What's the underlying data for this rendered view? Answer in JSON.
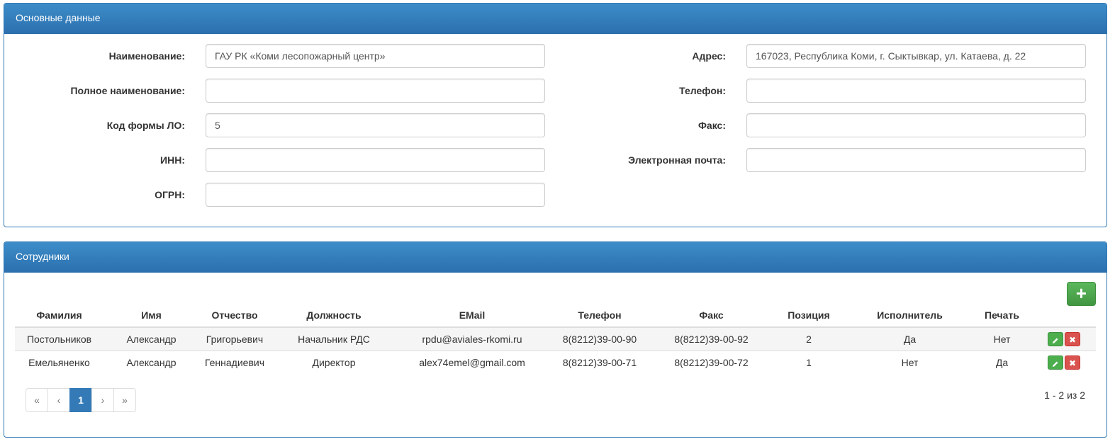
{
  "main_panel": {
    "title": "Основные данные",
    "left_fields": [
      {
        "label": "Наименование:",
        "value": "ГАУ РК «Коми лесопожарный центр»"
      },
      {
        "label": "Полное наименование:",
        "value": ""
      },
      {
        "label": "Код формы ЛО:",
        "value": "5"
      },
      {
        "label": "ИНН:",
        "value": ""
      },
      {
        "label": "ОГРН:",
        "value": ""
      }
    ],
    "right_fields": [
      {
        "label": "Адрес:",
        "value": "167023, Республика Коми, г. Сыктывкар, ул. Катаева, д. 22"
      },
      {
        "label": "Телефон:",
        "value": ""
      },
      {
        "label": "Факс:",
        "value": ""
      },
      {
        "label": "Электронная почта:",
        "value": ""
      }
    ]
  },
  "staff_panel": {
    "title": "Сотрудники",
    "add_icon": "plus-icon",
    "columns": [
      "Фамилия",
      "Имя",
      "Отчество",
      "Должность",
      "EMail",
      "Телефон",
      "Факс",
      "Позиция",
      "Исполнитель",
      "Печать"
    ],
    "rows": [
      [
        "Постольников",
        "Александр",
        "Григорьевич",
        "Начальник РДС",
        "rpdu@aviales-rkomi.ru",
        "8(8212)39-00-90",
        "8(8212)39-00-92",
        "2",
        "Да",
        "Нет"
      ],
      [
        "Емельяненко",
        "Александр",
        "Геннадиевич",
        "Директор",
        "alex74emel@gmail.com",
        "8(8212)39-00-71",
        "8(8212)39-00-72",
        "1",
        "Нет",
        "Да"
      ]
    ],
    "row_action_icons": [
      "pencil-icon",
      "remove-icon"
    ],
    "pagination": {
      "first": "«",
      "prev": "‹",
      "current": "1",
      "next": "›",
      "last": "»"
    },
    "page_info": "1 - 2 из 2"
  },
  "colors": {
    "primary": "#337ab7",
    "success": "#5cb85c",
    "danger": "#d9534f"
  }
}
